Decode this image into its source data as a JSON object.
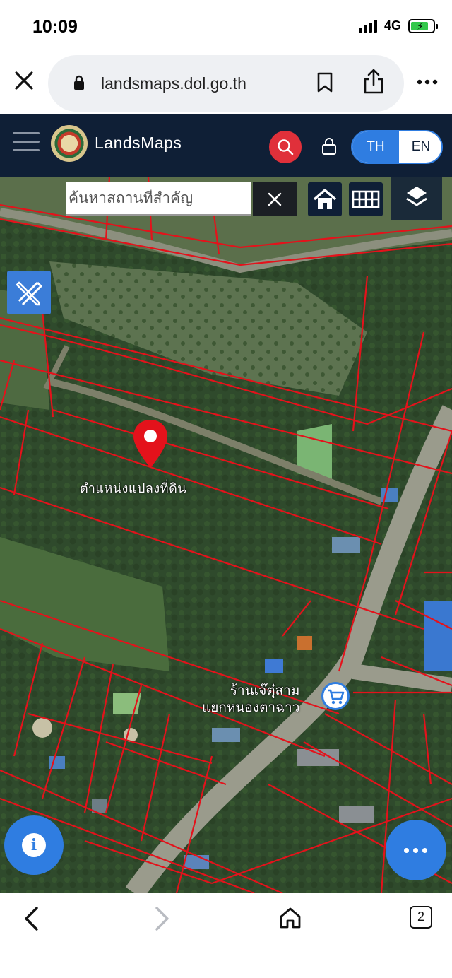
{
  "status": {
    "time": "10:09",
    "network": "4G"
  },
  "browser": {
    "url": "landsmaps.dol.go.th",
    "tab_count": "2"
  },
  "header": {
    "title": "LandsMaps",
    "lang_th": "TH",
    "lang_en": "EN",
    "accent_color": "#e0303a",
    "active_lang_color": "#2f7de1"
  },
  "map": {
    "search_placeholder": "ค้นหาสถานที่สำคัญ",
    "pin_label": "ตำแหน่งแปลงที่ดิน",
    "poi_label_line1": "ร้านเจ๊ตุ๋สาม",
    "poi_label_line2": "แยกหนองตาฉาว",
    "parcel_line_color": "#e4121b"
  }
}
